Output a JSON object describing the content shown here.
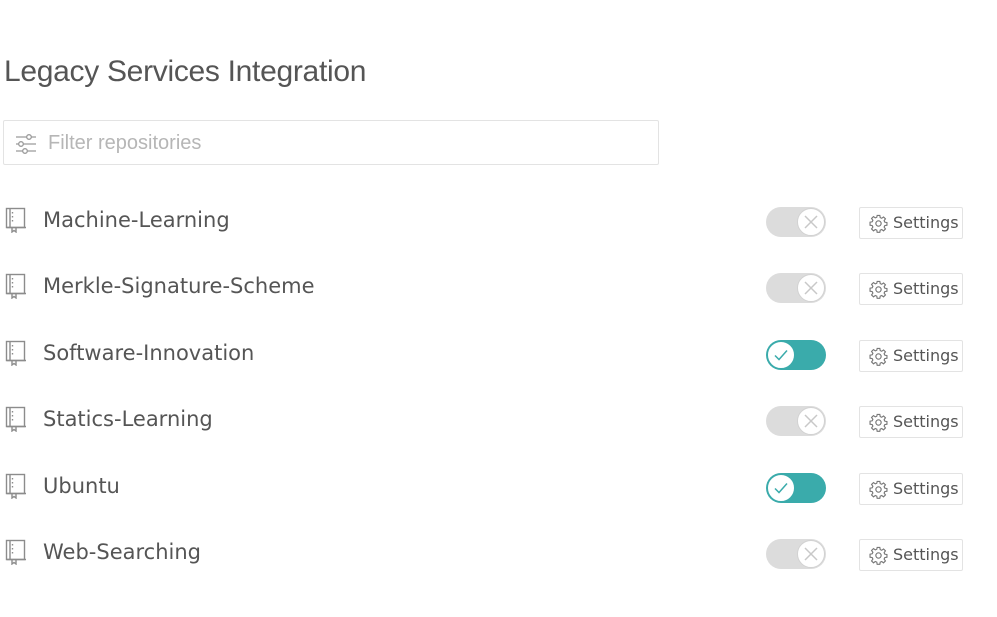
{
  "page": {
    "title": "Legacy Services Integration"
  },
  "filter": {
    "placeholder": "Filter repositories",
    "value": "",
    "icon": "sliders-icon"
  },
  "colors": {
    "accent": "#3aabab",
    "toggle_off": "#dcdcdc",
    "text": "#555555",
    "border": "#e3e3e3"
  },
  "repositories": [
    {
      "name": "Machine-Learning",
      "enabled": false,
      "settings_label": "Settings"
    },
    {
      "name": "Merkle-Signature-Scheme",
      "enabled": false,
      "settings_label": "Settings"
    },
    {
      "name": "Software-Innovation",
      "enabled": true,
      "settings_label": "Settings"
    },
    {
      "name": "Statics-Learning",
      "enabled": false,
      "settings_label": "Settings"
    },
    {
      "name": "Ubuntu",
      "enabled": true,
      "settings_label": "Settings"
    },
    {
      "name": "Web-Searching",
      "enabled": false,
      "settings_label": "Settings"
    }
  ],
  "icons": {
    "repo": "repo-book-icon",
    "settings": "gear-icon",
    "toggle_on": "check-icon",
    "toggle_off": "close-icon"
  }
}
